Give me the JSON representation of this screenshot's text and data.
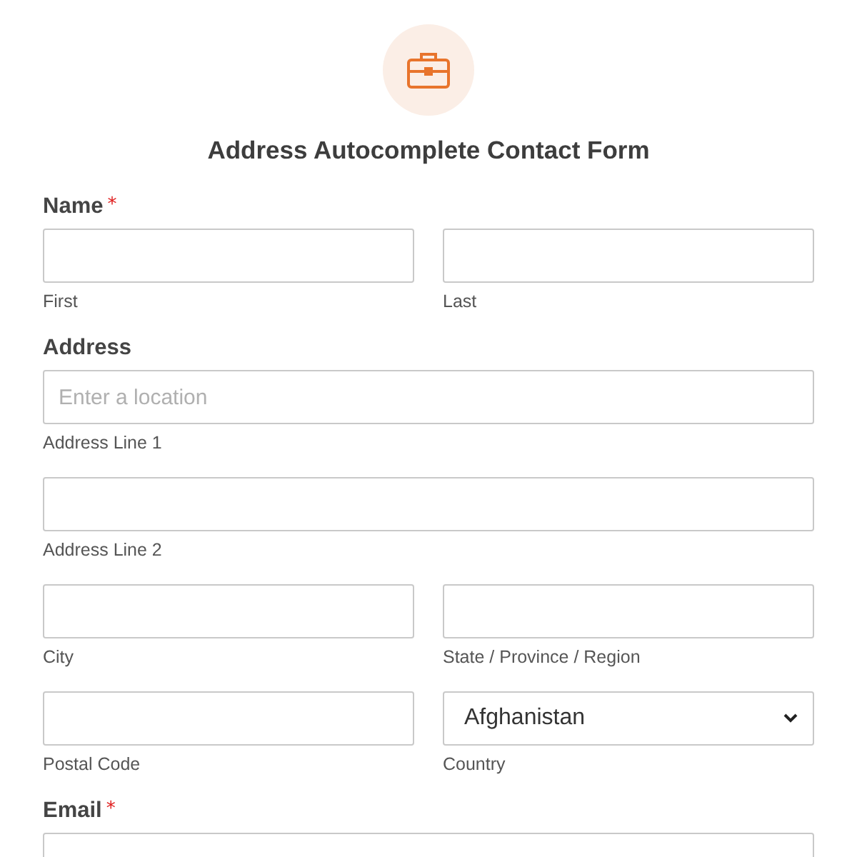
{
  "header": {
    "title": "Address Autocomplete Contact Form"
  },
  "fields": [
    {
      "label": "Name",
      "required_mark": "*",
      "rows": [
        [
          {
            "kind": "text",
            "sublabel": "First"
          },
          {
            "kind": "text",
            "sublabel": "Last"
          }
        ]
      ]
    },
    {
      "label": "Address",
      "rows": [
        [
          {
            "kind": "text",
            "placeholder": "Enter a location",
            "sublabel": "Address Line 1"
          }
        ],
        [
          {
            "kind": "text",
            "sublabel": "Address Line 2"
          }
        ],
        [
          {
            "kind": "text",
            "sublabel": "City"
          },
          {
            "kind": "text",
            "sublabel": "State / Province / Region"
          }
        ],
        [
          {
            "kind": "text",
            "sublabel": "Postal Code"
          },
          {
            "kind": "select",
            "value": "Afghanistan",
            "sublabel": "Country"
          }
        ]
      ]
    },
    {
      "label": "Email",
      "required_mark": "*",
      "rows": [
        [
          {
            "kind": "text"
          }
        ]
      ]
    }
  ]
}
